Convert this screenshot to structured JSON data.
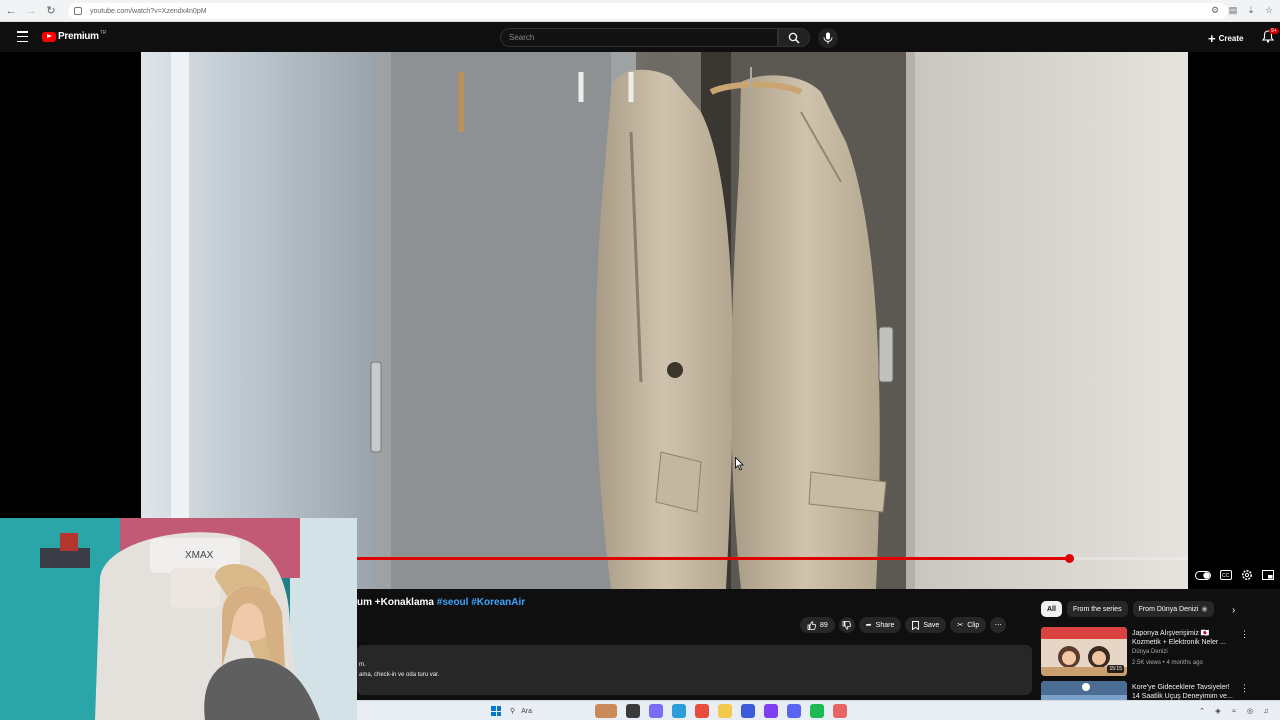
{
  "browser": {
    "url": "youtube.com/watch?v=Xzendx4n0pM",
    "nav_icons": [
      "back-icon",
      "forward-icon",
      "reload-icon",
      "site-info-icon"
    ],
    "extension_icons": [
      "translate-icon",
      "cast-icon",
      "download-icon",
      "bookmark-star-icon"
    ]
  },
  "header": {
    "logo_text": "Premium",
    "logo_region": "TR",
    "search_placeholder": "Search",
    "create_label": "Create",
    "notification_badge": "9+",
    "brand_color": "#ff0000"
  },
  "player": {
    "progress_fraction": 0.857,
    "buffered_fraction": 0.95,
    "progress_color": "#e00000",
    "controls": [
      "autoplay-toggle-icon",
      "captions-icon",
      "settings-icon",
      "miniplayer-icon"
    ]
  },
  "video": {
    "title_prefix": "um +Konaklama",
    "hashtags": [
      "#seoul",
      "#KoreanAir"
    ],
    "like_count": "89",
    "share_label": "Share",
    "save_label": "Save",
    "clip_label": "Clip",
    "description_lines": [
      "m.",
      "ama, check-in ve oda turu var."
    ]
  },
  "sidebar": {
    "chips": [
      "All",
      "From the series",
      "From Dünya Denizi"
    ],
    "recommendations": [
      {
        "title": "Japonya Alışverişimiz 🇯🇵 Kozmetik + Elektronik Neler ...",
        "channel": "Dünya Denizi",
        "meta": "2.5K views • 4 months ago",
        "duration": "15:15"
      },
      {
        "title": "Kore'ye Gideceklere Tavsiyeler! 14 Saatlik Uçuş Deneyimim ve...",
        "channel": "",
        "meta": "",
        "duration": ""
      }
    ]
  },
  "taskbar": {
    "search_placeholder": "Ara",
    "app_colors": [
      "#c98b5a",
      "#3a3a3a",
      "#7b6cf6",
      "#2d9cdb",
      "#e84c3d",
      "#f2c94c",
      "#3b5bdb",
      "#7e3ff2",
      "#5865f2",
      "#1db954",
      "#e66465"
    ]
  }
}
